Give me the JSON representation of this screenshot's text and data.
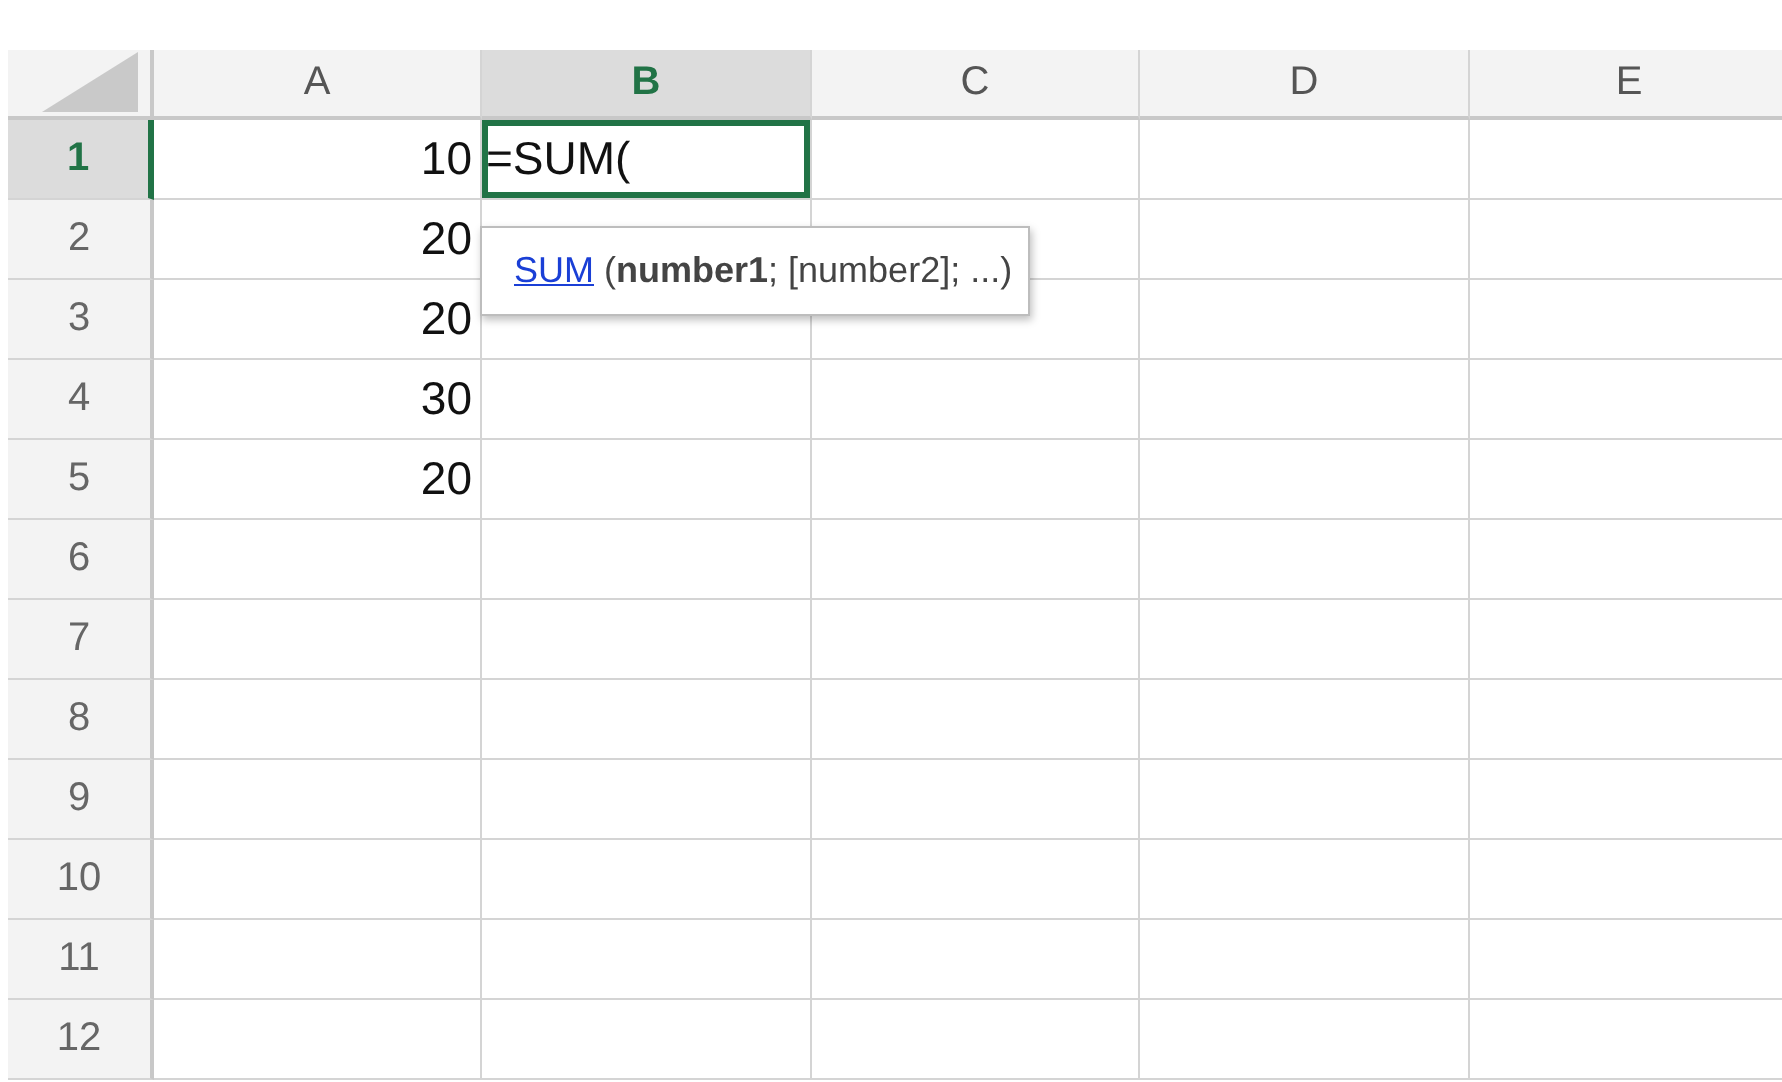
{
  "columns": [
    {
      "label": "A",
      "selected": false
    },
    {
      "label": "B",
      "selected": true
    },
    {
      "label": "C",
      "selected": false
    },
    {
      "label": "D",
      "selected": false
    },
    {
      "label": "E",
      "selected": false
    }
  ],
  "rows": [
    {
      "label": "1",
      "selected": true,
      "cells": [
        {
          "value": "10",
          "editing": false
        },
        {
          "value": "=SUM(",
          "editing": true
        }
      ]
    },
    {
      "label": "2",
      "selected": false,
      "cells": [
        {
          "value": "20",
          "editing": false
        }
      ]
    },
    {
      "label": "3",
      "selected": false,
      "cells": [
        {
          "value": "20",
          "editing": false
        }
      ]
    },
    {
      "label": "4",
      "selected": false,
      "cells": [
        {
          "value": "30",
          "editing": false
        }
      ]
    },
    {
      "label": "5",
      "selected": false,
      "cells": [
        {
          "value": "20",
          "editing": false
        }
      ]
    },
    {
      "label": "6",
      "selected": false
    },
    {
      "label": "7",
      "selected": false
    },
    {
      "label": "8",
      "selected": false
    },
    {
      "label": "9",
      "selected": false
    },
    {
      "label": "10",
      "selected": false
    },
    {
      "label": "11",
      "selected": false
    },
    {
      "label": "12",
      "selected": false
    }
  ],
  "tooltip": {
    "function": "SUM",
    "arguments": "(**number1**; [number2]; ...)"
  }
}
